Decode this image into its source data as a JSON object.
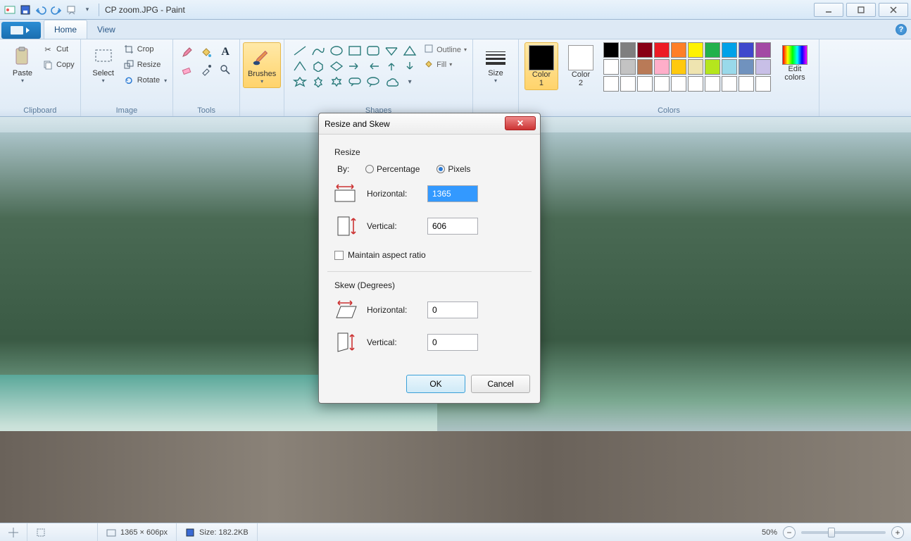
{
  "title": "CP zoom.JPG - Paint",
  "tabs": {
    "home": "Home",
    "view": "View"
  },
  "ribbon": {
    "clipboard": {
      "label": "Clipboard",
      "paste": "Paste",
      "cut": "Cut",
      "copy": "Copy"
    },
    "image": {
      "label": "Image",
      "select": "Select",
      "crop": "Crop",
      "resize": "Resize",
      "rotate": "Rotate"
    },
    "tools": {
      "label": "Tools"
    },
    "brushes": {
      "label": "Brushes"
    },
    "shapes": {
      "label": "Shapes",
      "outline": "Outline",
      "fill": "Fill"
    },
    "size": {
      "label": "Size"
    },
    "colors": {
      "label": "Colors",
      "color1": "Color\n1",
      "color2": "Color\n2",
      "edit": "Edit\ncolors",
      "color1_value": "#000000",
      "color2_value": "#ffffff",
      "palette_row1": [
        "#000000",
        "#7f7f7f",
        "#880015",
        "#ed1c24",
        "#ff7f27",
        "#fff200",
        "#22b14c",
        "#00a2e8",
        "#3f48cc",
        "#a349a4"
      ],
      "palette_row2": [
        "#ffffff",
        "#c3c3c3",
        "#b97a57",
        "#ffaec9",
        "#ffc90e",
        "#efe4b0",
        "#b5e61d",
        "#99d9ea",
        "#7092be",
        "#c8bfe7"
      ],
      "palette_row3": [
        "#ffffff",
        "#ffffff",
        "#ffffff",
        "#ffffff",
        "#ffffff",
        "#ffffff",
        "#ffffff",
        "#ffffff",
        "#ffffff",
        "#ffffff"
      ]
    }
  },
  "dialog": {
    "title": "Resize and Skew",
    "resize_label": "Resize",
    "by_label": "By:",
    "percentage": "Percentage",
    "pixels": "Pixels",
    "horizontal": "Horizontal:",
    "vertical": "Vertical:",
    "h_value": "1365",
    "v_value": "606",
    "maintain": "Maintain aspect ratio",
    "skew_label": "Skew (Degrees)",
    "skew_h_value": "0",
    "skew_v_value": "0",
    "ok": "OK",
    "cancel": "Cancel"
  },
  "status": {
    "dims": "1365 × 606px",
    "size_label": "Size: 182.2KB",
    "zoom": "50%"
  }
}
